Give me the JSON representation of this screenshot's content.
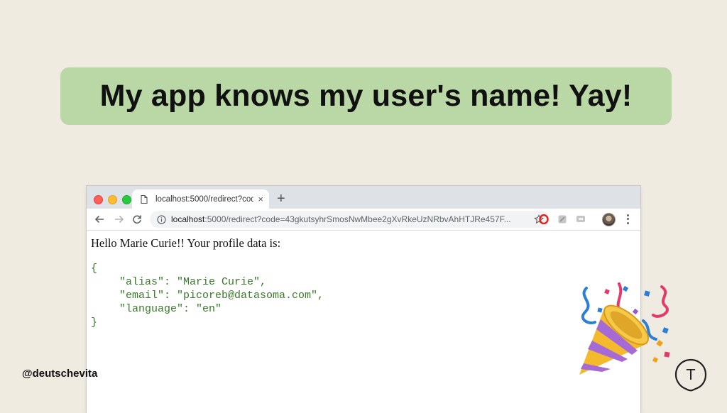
{
  "slide": {
    "headline": "My app knows my user's name! Yay!",
    "handle": "@deutschevita",
    "logo_letter": "T",
    "colors": {
      "background": "#efebe1",
      "banner": "#b9d8a6"
    }
  },
  "browser": {
    "tab": {
      "title": "localhost:5000/redirect?code=",
      "close_glyph": "×"
    },
    "new_tab_glyph": "+",
    "address_bar": {
      "host": "localhost",
      "rest": ":5000/redirect?code=43gkutsyhrSmosNwMbee2gXvRkeUzNRbvAhHTJRe457F..."
    },
    "icons": [
      "back-arrow-icon",
      "forward-arrow-icon",
      "reload-icon",
      "info-icon",
      "star-icon",
      "opera-icon",
      "extension-icon",
      "extension-icon",
      "avatar",
      "kebab-menu-icon"
    ]
  },
  "page": {
    "greeting": "Hello Marie Curie!! Your profile data is:",
    "json_open": "{",
    "json_lines": [
      "\"alias\": \"Marie Curie\",",
      "\"email\": \"picoreb@datasoma.com\",",
      "\"language\": \"en\""
    ],
    "json_close": "}",
    "json_color": "#3a7a2a"
  }
}
